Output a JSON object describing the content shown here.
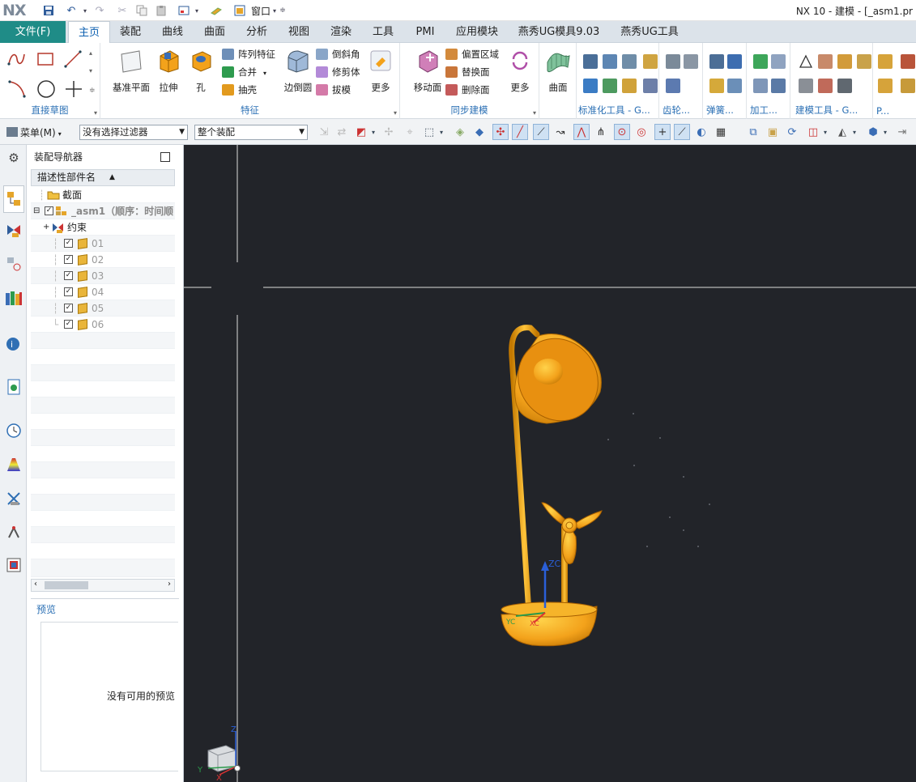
{
  "app": {
    "logo": "NX",
    "window_title": "NX 10 - 建模 - [_asm1.pr",
    "quick_access": {
      "window_menu": "窗口"
    }
  },
  "menubar": {
    "file_tab": "文件(F)",
    "tabs": [
      "主页",
      "装配",
      "曲线",
      "曲面",
      "分析",
      "视图",
      "渲染",
      "工具",
      "PMI",
      "应用模块",
      "燕秀UG模具9.03",
      "燕秀UG工具"
    ],
    "active_tab": "主页"
  },
  "ribbon": {
    "groups": {
      "sketch": "直接草图",
      "feature": "特征",
      "sync": "同步建模",
      "standard": "标准化工具 - G...",
      "gear": "齿轮...",
      "spring": "弹簧...",
      "machining": "加工...",
      "modeling_tools": "建模工具 - G...",
      "p": "P..."
    },
    "feature": {
      "datum_plane": "基准平面",
      "extrude": "拉伸",
      "hole": "孔",
      "pattern_feature": "阵列特征",
      "unite": "合并",
      "shell": "抽壳",
      "edge_blend": "边倒圆",
      "chamfer": "倒斜角",
      "trim_body": "修剪体",
      "draft": "拔模",
      "more": "更多"
    },
    "sync": {
      "move_face": "移动面",
      "offset_region": "偏置区域",
      "replace_face": "替换面",
      "delete_face": "删除面",
      "more": "更多"
    },
    "surface": {
      "surface": "曲面"
    }
  },
  "toolbar": {
    "menu": "菜单(M)",
    "filter": "没有选择过滤器",
    "scope": "整个装配"
  },
  "navigator": {
    "title": "装配导航器",
    "column_header": "描述性部件名",
    "items": [
      {
        "label": "截面"
      },
      {
        "label": "_asm1（顺序：时间顺"
      },
      {
        "label": "约束"
      },
      {
        "label": "01"
      },
      {
        "label": "02"
      },
      {
        "label": "03"
      },
      {
        "label": "04"
      },
      {
        "label": "05"
      },
      {
        "label": "06"
      }
    ],
    "preview_title": "预览",
    "preview_empty": "没有可用的预览"
  },
  "viewport": {
    "triad": {
      "zc": "ZC",
      "yc": "YC",
      "xc": "XC"
    },
    "corner_axes": {
      "z": "Z",
      "y": "Y",
      "x": "X"
    }
  },
  "colors": {
    "file_tab": "#1f8c87",
    "accent": "#0b5fb0",
    "viewport_bg": "#222429",
    "model": "#f3a21b"
  }
}
